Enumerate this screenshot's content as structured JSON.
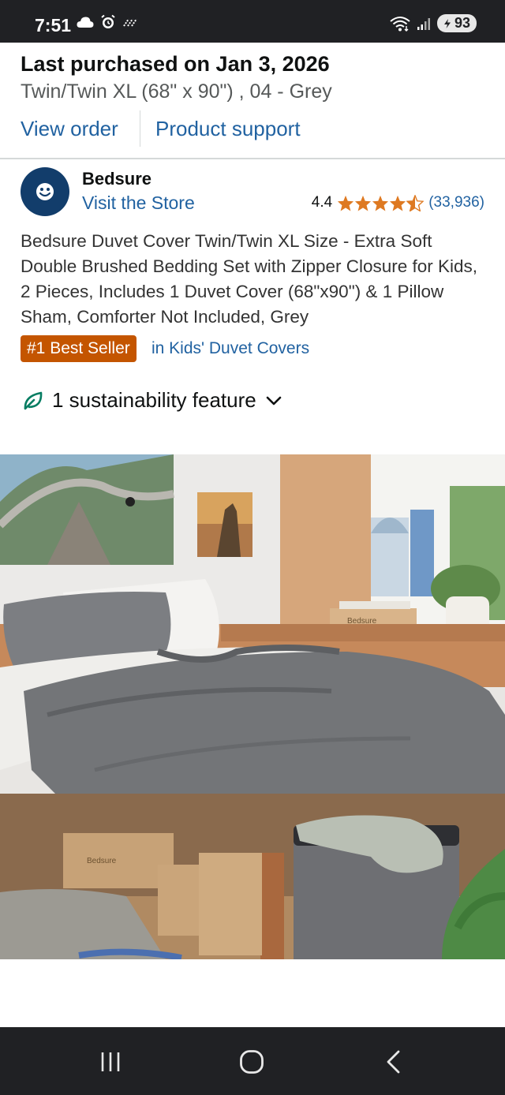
{
  "status_bar": {
    "time": "7:51",
    "battery": "93",
    "icons": [
      "cloud-icon",
      "alarm-icon",
      "signal-dots-icon",
      "wifi-icon",
      "cell-signal-icon",
      "battery-icon"
    ]
  },
  "order": {
    "last_purchased": "Last purchased on Jan 3, 2026",
    "variant": "Twin/Twin XL (68\" x 90\") , 04 - Grey",
    "view_order": "View order",
    "product_support": "Product support"
  },
  "brand": {
    "name": "Bedsure",
    "store_link": "Visit the Store",
    "logo_color": "#123d6b"
  },
  "rating": {
    "value": "4.4",
    "stars": 4.4,
    "reviews": "(33,936)",
    "star_color": "#de7921"
  },
  "product": {
    "title": "Bedsure Duvet Cover Twin/Twin XL Size - Extra Soft Double Brushed Bedding Set with Zipper Closure for Kids, 2 Pieces, Includes 1 Duvet Cover (68\"x90\") & 1 Pillow Sham, Comforter Not Included, Grey",
    "badge": "#1 Best Seller",
    "badge_category": "in Kids' Duvet Covers",
    "badge_color": "#c45500"
  },
  "sustainability": {
    "label": "1 sustainability feature",
    "icon": "leaf-icon",
    "icon_color": "#067d62"
  },
  "image": {
    "subject": "grey duvet cover bed in dorm room",
    "box_text_1": "Bedsure",
    "box_text_2": "Bedsure"
  },
  "nav_bar": {
    "buttons": [
      "recent-apps-icon",
      "home-icon",
      "back-icon"
    ]
  }
}
